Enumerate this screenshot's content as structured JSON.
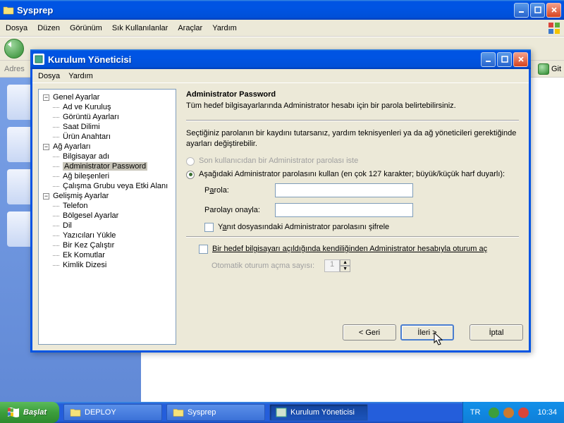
{
  "explorer": {
    "title": "Sysprep",
    "menu": {
      "file": "Dosya",
      "edit": "Düzen",
      "view": "Görünüm",
      "favorites": "Sık Kullanılanlar",
      "tools": "Araçlar",
      "help": "Yardım"
    },
    "address_label": "Adres",
    "go_label": "Git"
  },
  "dialog": {
    "title": "Kurulum Yöneticisi",
    "menu": {
      "file": "Dosya",
      "help": "Yardım"
    },
    "tree": {
      "general": "Genel Ayarlar",
      "name_org": "Ad ve Kuruluş",
      "display": "Görüntü Ayarları",
      "timezone": "Saat Dilimi",
      "product_key": "Ürün Anahtarı",
      "network": "Ağ Ayarları",
      "computer_name": "Bilgisayar adı",
      "admin_pw": "Administrator Password",
      "net_components": "Ağ bileşenleri",
      "workgroup": "Çalışma Grubu veya Etki Alanı",
      "advanced": "Gelişmiş Ayarlar",
      "telephony": "Telefon",
      "regional": "Bölgesel Ayarlar",
      "languages": "Dil",
      "printers": "Yazıcıları Yükle",
      "run_once": "Bir Kez Çalıştır",
      "additional": "Ek Komutlar",
      "id_strings": "Kimlik Dizesi"
    },
    "pane": {
      "heading": "Administrator Password",
      "desc": "Tüm hedef bilgisayarlarında Administrator hesabı için bir parola belirtebilirsiniz.",
      "info": "Seçtiğiniz parolanın bir kaydını tutarsanız, yardım teknisyenleri ya da ağ yöneticileri gerektiğinde ayarları değiştirebilir.",
      "radio_prompt": "Son kullanıcıdan bir Administrator parolası iste",
      "radio_use": "Aşağıdaki Administrator parolasını kullan (en çok 127 karakter; büyük/küçük harf duyarlı):",
      "password_label_pre": "P",
      "password_label_u": "a",
      "password_label_post": "rola:",
      "confirm_label": "Parolayı onayla:",
      "encrypt_pre": "Y",
      "encrypt_u": "a",
      "encrypt_post": "nıt dosyasındaki Administrator parolasını şifrele",
      "autologon": "Bir hedef bilgisayarı açıldığında kendiliğinden Administrator hesabıyla oturum aç",
      "autologon_count": "Otomatik oturum açma sayısı:",
      "spinner_value": "1"
    },
    "buttons": {
      "back": "< Geri",
      "next": "İleri >",
      "cancel": "İptal"
    }
  },
  "taskbar": {
    "start": "Başlat",
    "tasks": {
      "deploy": "DEPLOY",
      "sysprep": "Sysprep",
      "setup": "Kurulum Yöneticisi"
    },
    "lang": "TR",
    "time": "10:34"
  }
}
